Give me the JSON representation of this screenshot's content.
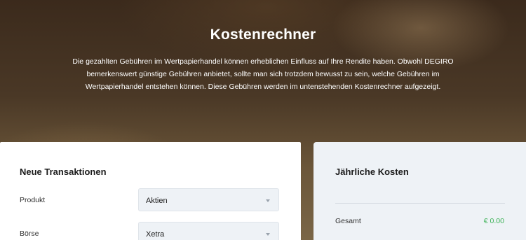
{
  "hero": {
    "title": "Kostenrechner",
    "description": "Die gezahlten Gebühren im Wertpapierhandel können erheblichen Einfluss auf Ihre Rendite haben. Obwohl DEGIRO bemerkenswert günstige Gebühren anbietet, sollte man sich trotzdem bewusst zu sein, welche Gebühren im Wertpapierhandel entstehen können. Diese Gebühren werden im untenstehenden Kostenrechner aufgezeigt."
  },
  "transactions": {
    "title": "Neue Transaktionen",
    "fields": [
      {
        "label": "Produkt",
        "value": "Aktien",
        "icon": "chevron-down-icon"
      },
      {
        "label": "Börse",
        "value": "Xetra",
        "icon": "chevron-down-icon"
      }
    ]
  },
  "annual_costs": {
    "title": "Jährliche Kosten",
    "total_label": "Gesamt",
    "total_value": "€ 0.00",
    "total_color": "#3db257"
  }
}
